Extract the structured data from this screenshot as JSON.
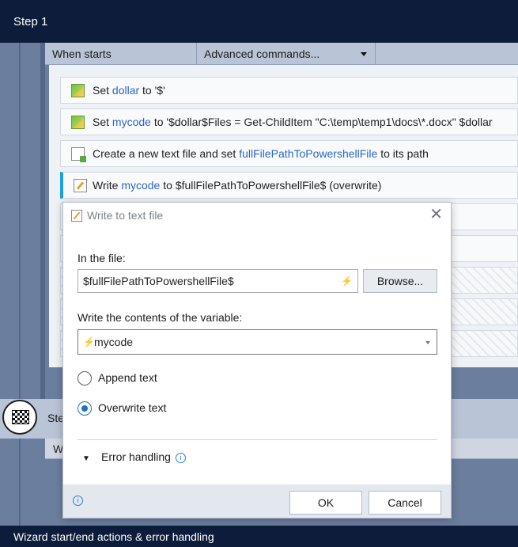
{
  "step1": {
    "title": "Step 1"
  },
  "steprow": {
    "when_starts": "When starts",
    "advanced": "Advanced commands..."
  },
  "actions": [
    {
      "verb": "Set",
      "var": "dollar",
      "mid": "to",
      "rest": "'$'",
      "icon": "set-variable-icon"
    },
    {
      "verb": "Set",
      "var": "mycode",
      "mid": "to",
      "rest": "'$dollar$Files = Get-ChildItem \"C:\\temp\\temp1\\docs\\*.docx\"   $dollar",
      "icon": "set-variable-icon"
    },
    {
      "verb": "Create a new text file and set",
      "var": "fullFilePathToPowershellFile",
      "mid": "to its path",
      "rest": "",
      "icon": "new-file-icon"
    },
    {
      "verb": "Write",
      "var": "mycode",
      "mid": "to",
      "rest": "$fullFilePathToPowershellFile$ (overwrite)",
      "icon": "write-file-icon"
    }
  ],
  "step2": {
    "label_partial": "Ste",
    "sub_partial": "W"
  },
  "bottombar": {
    "label": "Wizard start/end actions & error handling"
  },
  "dialog": {
    "title": "Write to text file",
    "in_the_file_label": "In the file:",
    "file_value": "$fullFilePathToPowershellFile$",
    "browse_label": "Browse...",
    "contents_label": "Write the contents of the variable:",
    "variable_value": "mycode",
    "append_label": "Append text",
    "overwrite_label": "Overwrite text",
    "selected_mode": "Overwrite text",
    "error_handling_label": "Error handling",
    "ok_label": "OK",
    "cancel_label": "Cancel"
  },
  "colors": {
    "accent": "#1ca0e0",
    "variable": "#2a66c7",
    "header": "#0c1c3a"
  }
}
